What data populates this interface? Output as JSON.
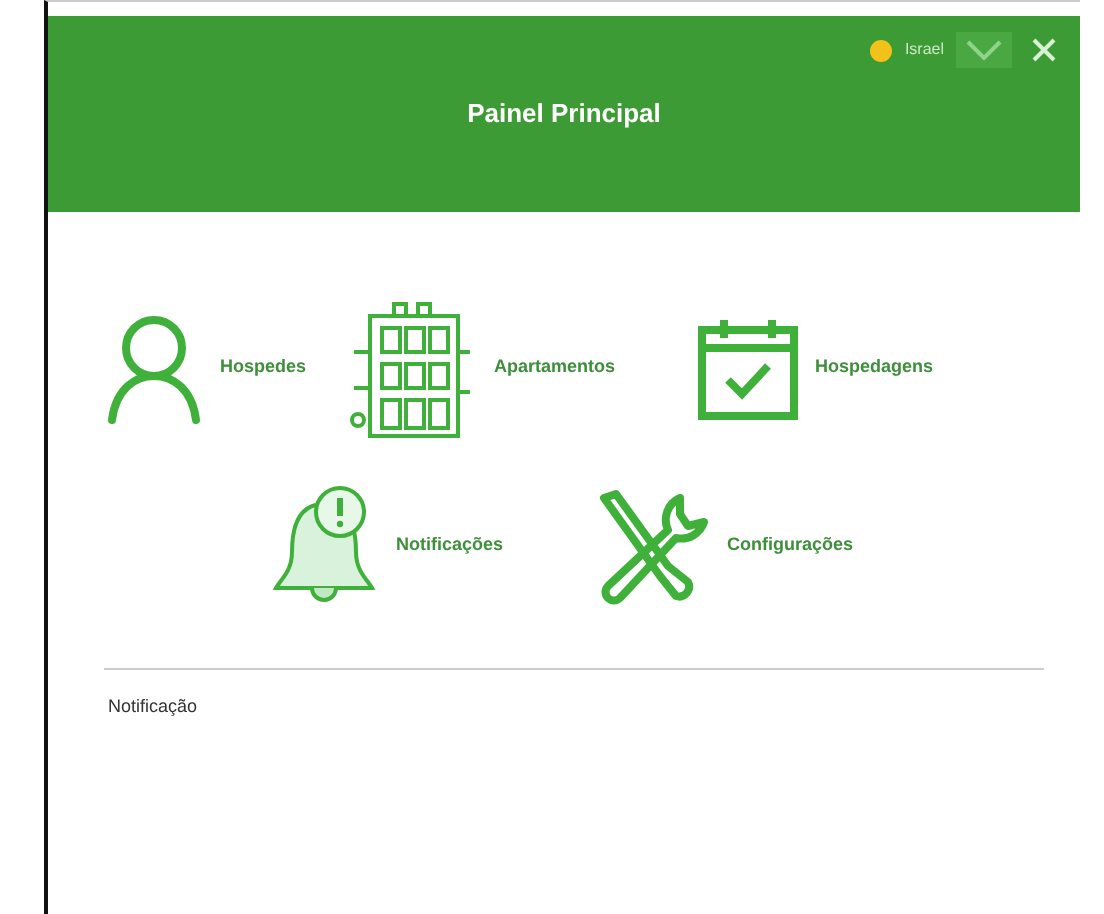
{
  "header": {
    "title": "Painel Principal",
    "user": {
      "name": "Israel",
      "online": true
    }
  },
  "menu_rows": [
    [
      {
        "label": "Hospedes",
        "kind": "person"
      },
      {
        "label": "Apartamentos",
        "kind": "building"
      },
      {
        "label": "Hospedagens",
        "kind": "calendar"
      }
    ],
    [
      {
        "label": "Notificações",
        "kind": "bell"
      },
      {
        "label": "Configurações",
        "kind": "tools"
      }
    ]
  ],
  "notification_label": "Notificação"
}
